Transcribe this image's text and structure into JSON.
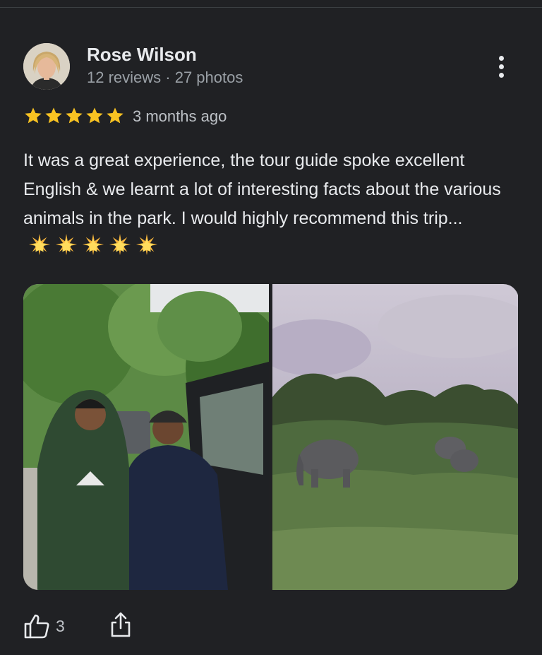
{
  "review": {
    "author_name": "Rose Wilson",
    "author_meta": "12 reviews · 27 photos",
    "rating": 5,
    "time_ago": "3 months ago",
    "text": "It was a great experience, the tour guide spoke excellent English & we learnt a lot of interesting facts about the various animals in the park. I would highly recommend this trip...",
    "emoji_count": 5,
    "photos": [
      {
        "icon": "photo-guides-by-jeep"
      },
      {
        "icon": "photo-elephants-in-bush"
      }
    ]
  },
  "actions": {
    "like_count": "3",
    "like_icon": "thumb-up-icon",
    "share_icon": "share-icon",
    "more_icon": "more-vertical-icon"
  },
  "colors": {
    "background": "#202124",
    "star": "#f9c322",
    "primary_text": "#e8eaed",
    "secondary_text": "#9aa0a6"
  }
}
